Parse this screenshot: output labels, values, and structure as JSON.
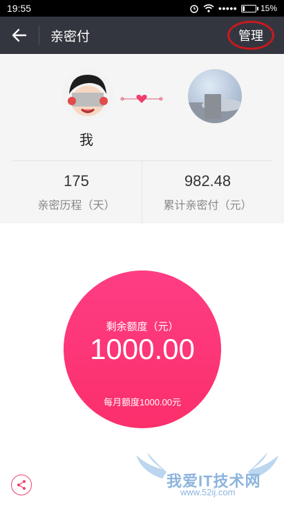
{
  "status_bar": {
    "time": "19:55",
    "signal": "●●●●●",
    "battery": "15%",
    "battery_fraction": 0.15
  },
  "nav": {
    "title": "亲密付",
    "manage_label": "管理"
  },
  "couple": {
    "me_name": "我",
    "partner_name": ""
  },
  "stats": [
    {
      "value": "175",
      "label": "亲密历程（天）"
    },
    {
      "value": "982.48",
      "label": "累计亲密付（元）"
    }
  ],
  "quota": {
    "label": "剩余额度（元）",
    "value": "1000.00",
    "monthly": "每月额度1000.00元"
  },
  "watermark": {
    "text": "我爱IT技术网",
    "url": "www.52ij.com"
  },
  "colors": {
    "accent": "#fb2f6b",
    "nav": "#34363f",
    "highlight_circle": "#c9191e"
  }
}
